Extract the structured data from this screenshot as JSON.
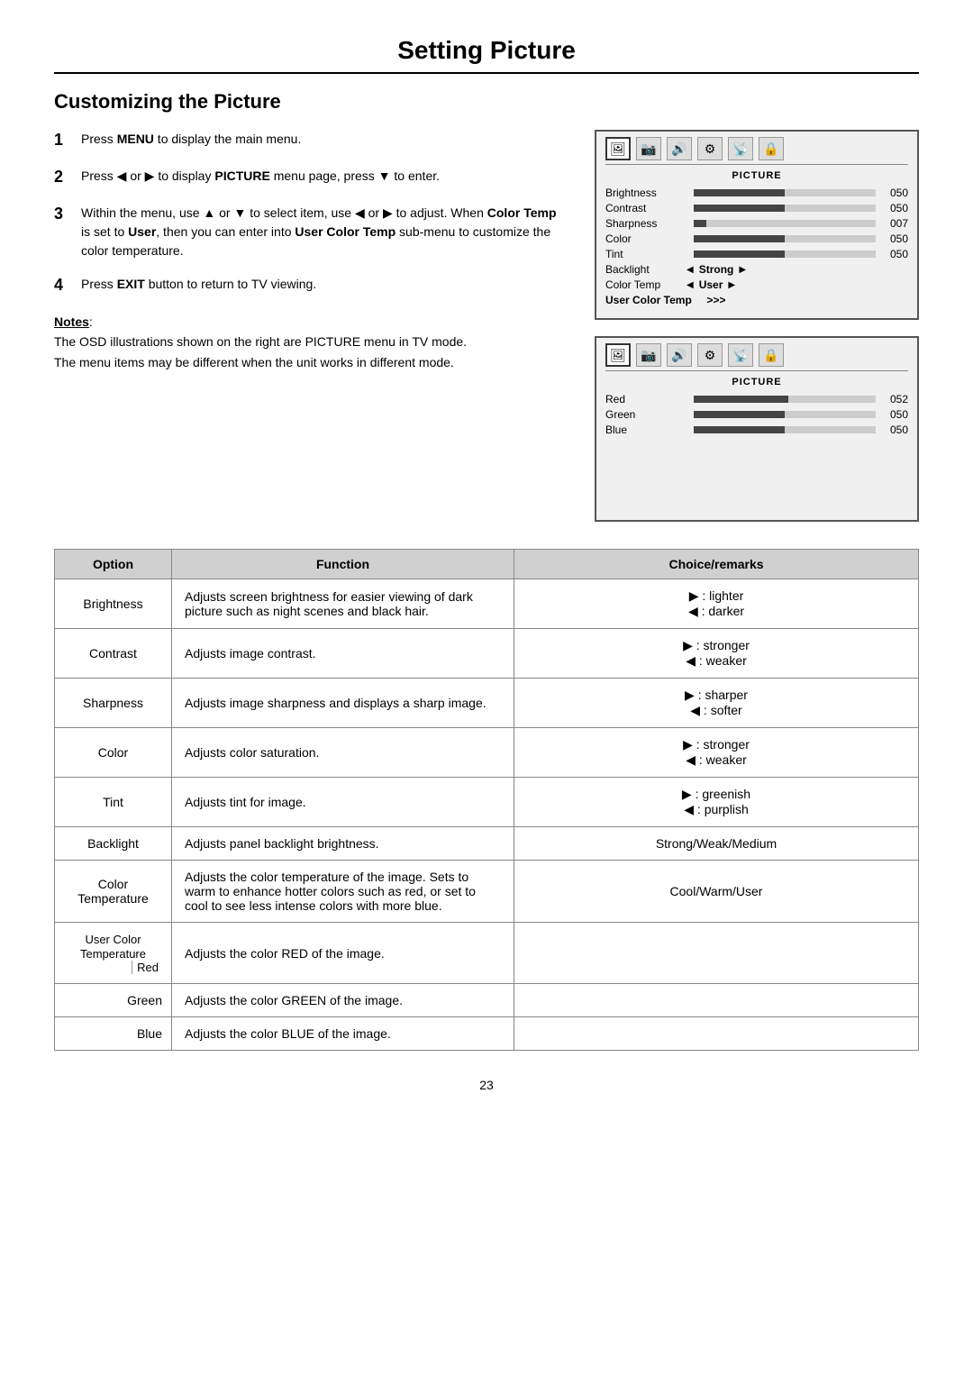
{
  "page": {
    "title": "Setting Picture",
    "section_title": "Customizing the Picture",
    "page_number": "23"
  },
  "instructions": [
    {
      "step": "1",
      "text_parts": [
        "Press ",
        "MENU",
        " to display the main menu."
      ],
      "bold_word": "MENU"
    },
    {
      "step": "2",
      "text_parts": [
        "Press  ◀ or ▶  to display ",
        "PICTURE",
        " menu page, press  ▼  to enter."
      ],
      "bold_word": "PICTURE"
    },
    {
      "step": "3",
      "text_parts": [
        "Within the menu, use  ▲ or ▼  to select item, use  ◀ or ▶  to adjust. When ",
        "Color Temp",
        " is set to ",
        "User",
        ", then you can enter into ",
        "User Color Temp",
        " sub-menu to customize the color temperature."
      ]
    },
    {
      "step": "4",
      "text_parts": [
        "Press ",
        "EXIT",
        " button to return to TV viewing."
      ]
    }
  ],
  "notes": {
    "title": "Notes",
    "lines": [
      "The OSD illustrations shown on the right are PICTURE menu in TV mode.",
      "The menu items may be different when the unit works in different mode."
    ]
  },
  "osd_screen1": {
    "label": "PICTURE",
    "icons": [
      "🖼",
      "📷",
      "🔊",
      "⚙",
      "📡",
      "🔒"
    ],
    "rows": [
      {
        "name": "Brightness",
        "type": "bar",
        "fill": 50,
        "value": "050"
      },
      {
        "name": "Contrast",
        "type": "bar",
        "fill": 50,
        "value": "050"
      },
      {
        "name": "Sharpness",
        "type": "bar",
        "fill": 7,
        "value": "007"
      },
      {
        "name": "Color",
        "type": "bar",
        "fill": 50,
        "value": "050"
      },
      {
        "name": "Tint",
        "type": "bar",
        "fill": 50,
        "value": "050"
      },
      {
        "name": "Backlight",
        "type": "selector",
        "value": "Strong"
      },
      {
        "name": "Color Temp",
        "type": "selector",
        "value": "User"
      }
    ],
    "subrow": "User Color Temp   >>>"
  },
  "osd_screen2": {
    "label": "PICTURE",
    "icons": [
      "🖼",
      "📷",
      "🔊",
      "⚙",
      "📡",
      "🔒"
    ],
    "rows": [
      {
        "name": "Red",
        "type": "bar",
        "fill": 52,
        "value": "052"
      },
      {
        "name": "Green",
        "type": "bar",
        "fill": 50,
        "value": "050"
      },
      {
        "name": "Blue",
        "type": "bar",
        "fill": 50,
        "value": "050"
      }
    ]
  },
  "table": {
    "headers": [
      "Option",
      "Function",
      "Choice/remarks"
    ],
    "rows": [
      {
        "option": "Brightness",
        "function": "Adjusts screen brightness for easier viewing of dark picture such as night scenes and black hair.",
        "choice": "▶ : lighter\n◀ : darker"
      },
      {
        "option": "Contrast",
        "function": "Adjusts image contrast.",
        "choice": "▶ : stronger\n◀ : weaker"
      },
      {
        "option": "Sharpness",
        "function": "Adjusts image sharpness and displays a sharp image.",
        "choice": "▶ : sharper\n◀ : softer"
      },
      {
        "option": "Color",
        "function": "Adjusts color saturation.",
        "choice": "▶ : stronger\n◀ : weaker"
      },
      {
        "option": "Tint",
        "function": "Adjusts tint for image.",
        "choice": "▶ : greenish\n◀ : purplish"
      },
      {
        "option": "Backlight",
        "function": "Adjusts panel backlight brightness.",
        "choice": "Strong/Weak/Medium"
      },
      {
        "option": "Color\nTemperature",
        "function": "Adjusts the color temperature of the image. Sets to warm to enhance hotter colors such as red, or set to cool to see less intense colors with more blue.",
        "choice": "Cool/Warm/User"
      },
      {
        "option_main": "User Color\nTemperature",
        "option_sub": "Red",
        "function": "Adjusts the color RED of the image.",
        "choice": ""
      },
      {
        "option_main": "",
        "option_sub": "Green",
        "function": "Adjusts the color GREEN of the image.",
        "choice": ""
      },
      {
        "option_main": "",
        "option_sub": "Blue",
        "function": "Adjusts the color BLUE of the image.",
        "choice": ""
      }
    ]
  }
}
